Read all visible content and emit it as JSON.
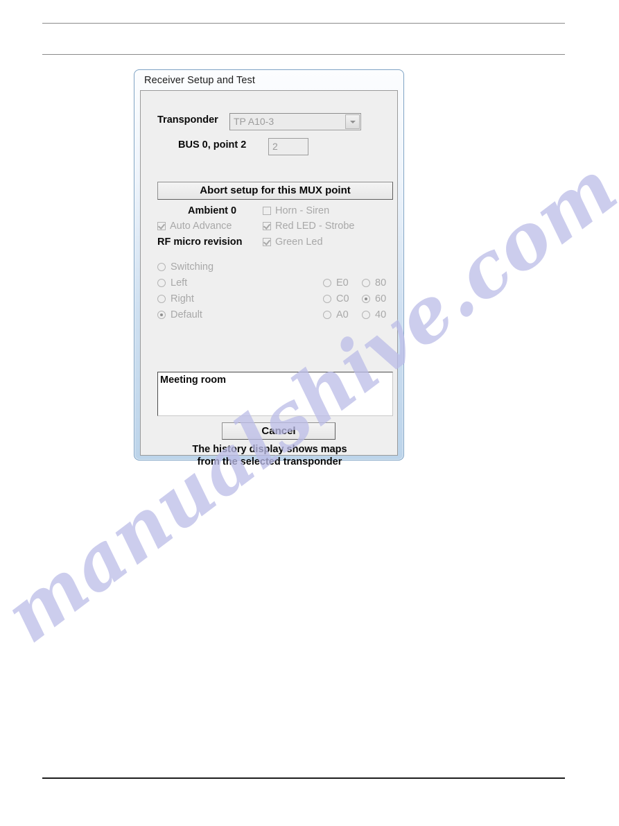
{
  "page": {
    "rules": [
      "top-rule",
      "second-rule",
      "bottom-rule"
    ],
    "watermark_text": "manualshive.com"
  },
  "dialog": {
    "title": "Receiver Setup and Test",
    "transponder": {
      "label": "Transponder",
      "value": "TP A10-3",
      "placeholder": "TP A10-3"
    },
    "bus_point": {
      "label": "BUS 0, point 2",
      "value": "2",
      "placeholder": "2"
    },
    "abort_button": "Abort setup for this MUX point",
    "status": {
      "ambient": "Ambient 0",
      "rf_micro": "RF micro revision"
    },
    "checkboxes": [
      {
        "label": "Auto Advance",
        "checked": true,
        "enabled": false
      },
      {
        "label": "Horn - Siren",
        "checked": false,
        "enabled": false
      },
      {
        "label": "Red LED - Strobe",
        "checked": true,
        "enabled": false
      },
      {
        "label": "Green Led",
        "checked": true,
        "enabled": false
      }
    ],
    "mode_radios": [
      {
        "label": "Switching",
        "selected": false
      },
      {
        "label": "Left",
        "selected": false
      },
      {
        "label": "Right",
        "selected": false
      },
      {
        "label": "Default",
        "selected": true
      }
    ],
    "level_radios_left": [
      {
        "label": "E0",
        "selected": false
      },
      {
        "label": "C0",
        "selected": false
      },
      {
        "label": "A0",
        "selected": false
      }
    ],
    "level_radios_right": [
      {
        "label": "80",
        "selected": false
      },
      {
        "label": "60",
        "selected": true
      },
      {
        "label": "40",
        "selected": false
      }
    ],
    "memo": {
      "value": "Meeting room",
      "placeholder": "Meeting room"
    },
    "cancel_button": "Cancel",
    "note_line1": "The history display shows maps",
    "note_line2": "from the selected transponder"
  },
  "colors": {
    "window_border": "#7da2c4",
    "title_gradient_start": "#fcfdfe",
    "title_gradient_end": "#bcd4ea",
    "dialog_face": "#efefef",
    "disabled_text": "#a8a8a8",
    "watermark": "#bcbde8",
    "rule": "#8a8a8a"
  }
}
